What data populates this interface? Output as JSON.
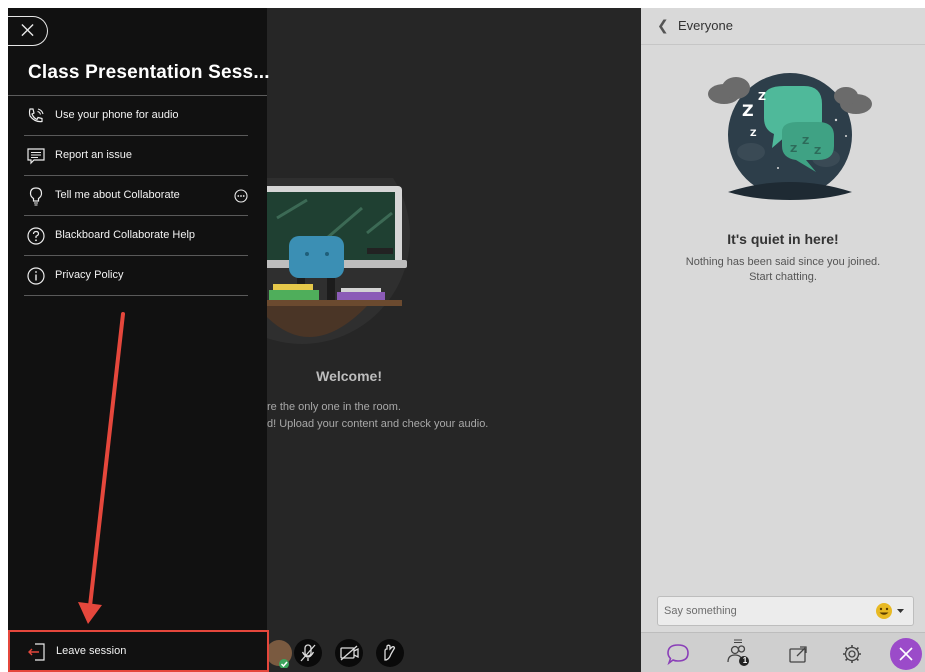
{
  "menu": {
    "session_title": "Class Presentation Sess...",
    "items": [
      {
        "label": "Use your phone for audio",
        "icon": "phone-audio-icon"
      },
      {
        "label": "Report an issue",
        "icon": "report-issue-icon"
      },
      {
        "label": "Tell me about Collaborate",
        "icon": "lightbulb-icon"
      },
      {
        "label": "Blackboard Collaborate Help",
        "icon": "help-icon"
      },
      {
        "label": "Privacy Policy",
        "icon": "info-icon"
      }
    ],
    "leave_label": "Leave session"
  },
  "stage": {
    "welcome_title": "Welcome!",
    "welcome_line1": "re the only one in the room.",
    "welcome_line2": "d! Upload your content and check your audio."
  },
  "chat": {
    "header_title": "Everyone",
    "quiet_title": "It's quiet in here!",
    "quiet_line1": "Nothing has been said since you joined.",
    "quiet_line2": "Start chatting.",
    "input_placeholder": "Say something",
    "attendee_badge": "1"
  },
  "colors": {
    "highlight": "#e5473c",
    "accent_purple": "#9b4bc9",
    "chat_icon": "#8a3fb8"
  }
}
